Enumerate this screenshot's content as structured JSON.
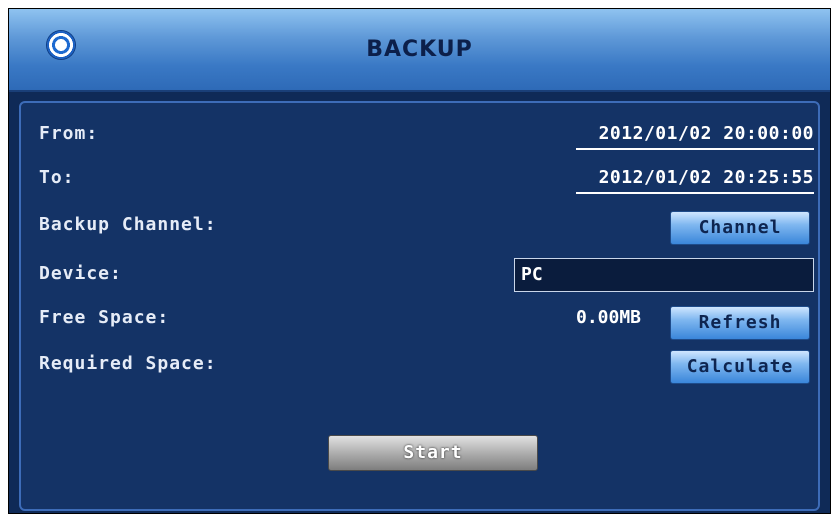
{
  "window": {
    "title": "BACKUP"
  },
  "form": {
    "from_label": "From:",
    "from_value": "2012/01/02 20:00:00",
    "to_label": "To:",
    "to_value": "2012/01/02 20:25:55",
    "channel_label": "Backup Channel:",
    "channel_button": "Channel",
    "device_label": "Device:",
    "device_value": "PC",
    "free_label": "Free Space:",
    "free_value": "0.00MB",
    "refresh_button": "Refresh",
    "required_label": "Required Space:",
    "calculate_button": "Calculate",
    "start_button": "Start"
  },
  "icons": {
    "title_icon": "target-icon"
  },
  "colors": {
    "panel_bg": "#143366",
    "title_bar": "#3a79c5",
    "button_blue": "#7fb7f0",
    "button_gray": "#b3b3b3"
  }
}
